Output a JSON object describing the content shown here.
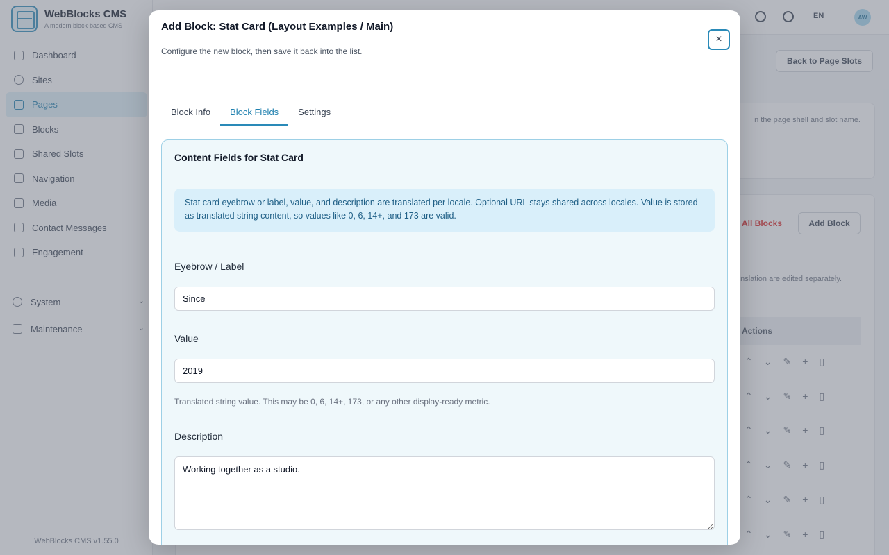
{
  "app": {
    "brand_name": "WebBlocks CMS",
    "brand_tagline": "A modern block-based CMS",
    "version": "WebBlocks CMS v1.55.0",
    "nav": [
      {
        "label": "Dashboard",
        "icon": "dashboard-icon"
      },
      {
        "label": "Sites",
        "icon": "globe-icon"
      },
      {
        "label": "Pages",
        "icon": "page-icon",
        "active": true
      },
      {
        "label": "Blocks",
        "icon": "cube-icon"
      },
      {
        "label": "Shared Slots",
        "icon": "layers-icon"
      },
      {
        "label": "Navigation",
        "icon": "menu-icon"
      },
      {
        "label": "Media",
        "icon": "image-icon"
      },
      {
        "label": "Contact Messages",
        "icon": "mail-icon"
      },
      {
        "label": "Engagement",
        "icon": "star-icon"
      }
    ],
    "nav_groups": [
      {
        "label": "System",
        "icon": "gear-icon"
      },
      {
        "label": "Maintenance",
        "icon": "file-icon"
      }
    ],
    "lang": "EN",
    "avatar": "AW",
    "back_button": "Back to Page Slots",
    "slot_hint": "n the page shell and slot name.",
    "delete_all": "All Blocks",
    "add_block": "Add Block",
    "translation_hint": "anslation are edited separately.",
    "actions_header": "Actions"
  },
  "modal": {
    "title": "Add Block: Stat Card (Layout Examples / Main)",
    "subtitle": "Configure the new block, then save it back into the list.",
    "close_label": "×",
    "tabs": [
      {
        "label": "Block Info"
      },
      {
        "label": "Block Fields",
        "active": true
      },
      {
        "label": "Settings"
      }
    ],
    "fields_title": "Content Fields for Stat Card",
    "info": "Stat card eyebrow or label, value, and description are translated per locale. Optional URL stays shared across locales. Value is stored as translated string content, so values like 0, 6, 14+, and 173 are valid.",
    "eyebrow_label": "Eyebrow / Label",
    "eyebrow_value": "Since",
    "value_label": "Value",
    "value_value": "2019",
    "value_help": "Translated string value. This may be 0, 6, 14+, 173, or any other display-ready metric.",
    "description_label": "Description",
    "description_value": "Working together as a studio."
  }
}
